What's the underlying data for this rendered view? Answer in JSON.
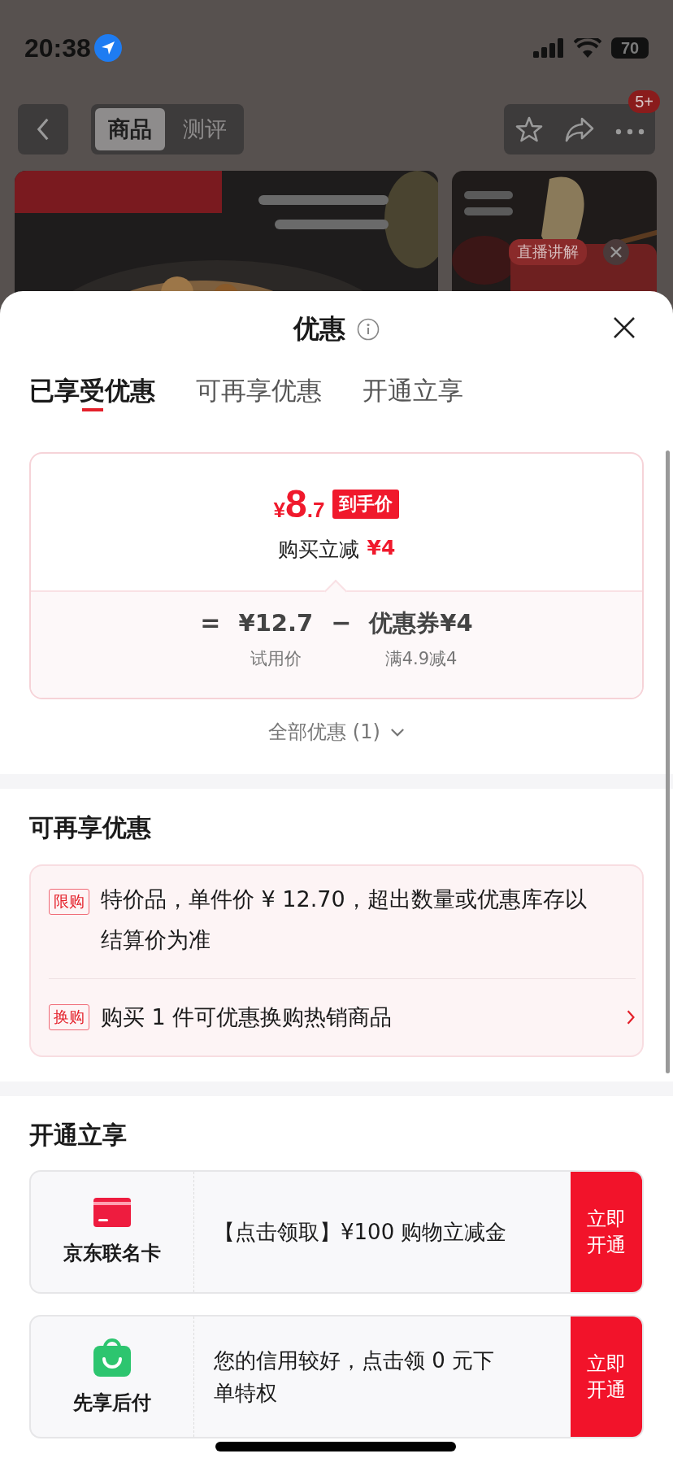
{
  "status_bar": {
    "time": "20:38",
    "battery": "70"
  },
  "nav": {
    "tabs": [
      {
        "label": "商品",
        "selected": true
      },
      {
        "label": "测评",
        "selected": false
      }
    ],
    "badge": "5+"
  },
  "live": {
    "label": "直播讲解"
  },
  "sheet": {
    "title": "优惠",
    "tabs": [
      {
        "label": "已享受优惠",
        "selected": true
      },
      {
        "label": "可再享优惠",
        "selected": false
      },
      {
        "label": "开通立享",
        "selected": false
      }
    ],
    "price": {
      "currency": "¥",
      "integer": "8",
      "decimal": ".7",
      "tag": "到手价",
      "saving_label": "购买立减",
      "saving": "¥4"
    },
    "formula": {
      "equals": "=",
      "terms": [
        {
          "value": "¥12.7",
          "caption": "试用价"
        },
        {
          "operator": "−",
          "value": "优惠券¥4",
          "caption": "满4.9减4"
        }
      ]
    },
    "all_offers": "全部优惠 (1)",
    "more_section": {
      "title": "可再享优惠",
      "rows": [
        {
          "tag": "限购",
          "text": "特价品，单件价 ¥ 12.70，超出数量或优惠库存以结算价为准",
          "link": false
        },
        {
          "tag": "换购",
          "text": "购买 1 件可优惠换购热销商品",
          "link": true
        }
      ]
    },
    "open_section": {
      "title": "开通立享",
      "cards": [
        {
          "kind": "card",
          "name": "京东联名卡",
          "text": "【点击领取】¥100 购物立减金",
          "button": "立即开通"
        },
        {
          "kind": "bag",
          "name": "先享后付",
          "text": "您的信用较好，点击领 0 元下单特权",
          "button": "立即开通"
        }
      ]
    }
  }
}
